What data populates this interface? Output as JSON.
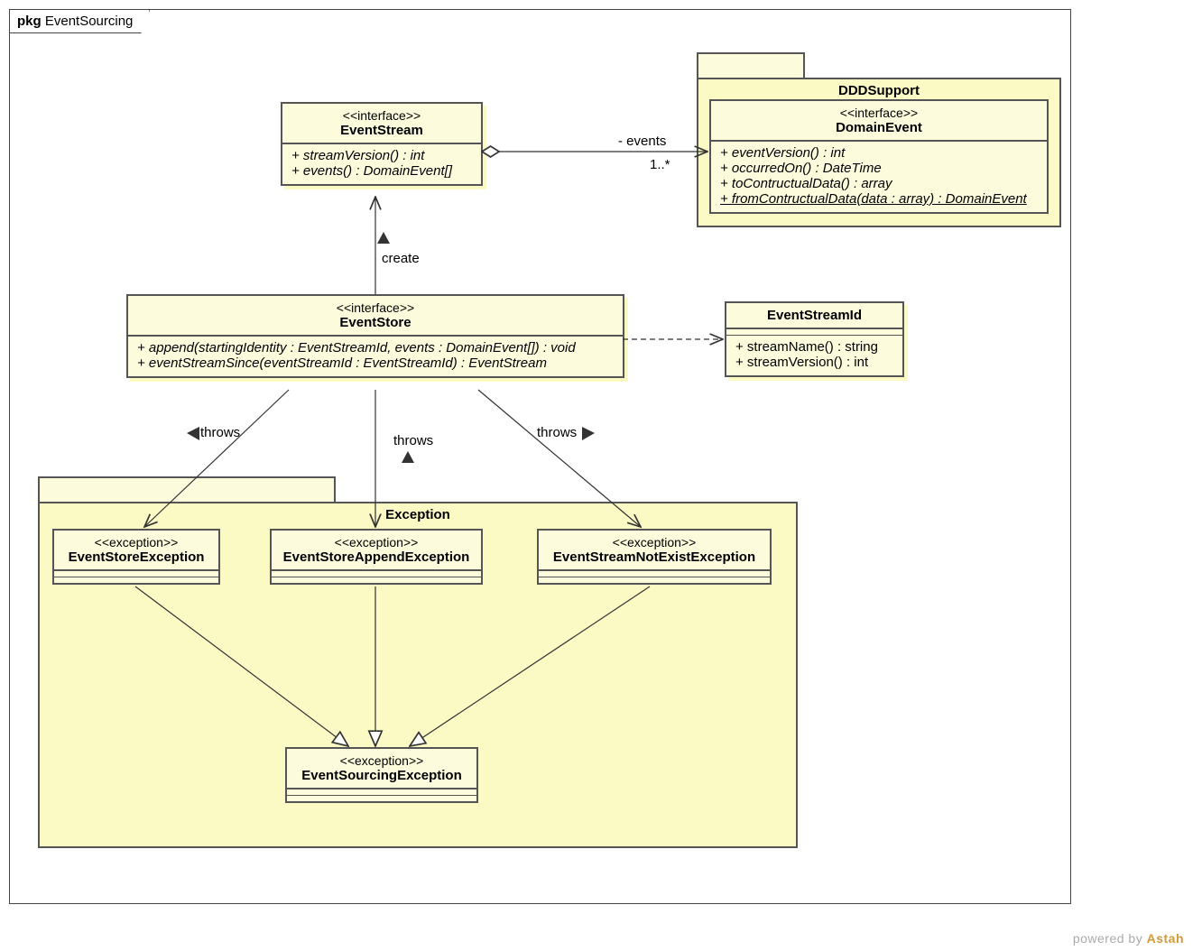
{
  "frame": {
    "prefix": "pkg",
    "name": "EventSourcing"
  },
  "eventStream": {
    "stereo": "<<interface>>",
    "name": "EventStream",
    "ops": [
      "+ streamVersion() : int",
      "+ events() : DomainEvent[]"
    ]
  },
  "dddSupportPkg": {
    "name": "DDDSupport"
  },
  "domainEvent": {
    "stereo": "<<interface>>",
    "name": "DomainEvent",
    "ops": [
      "+ eventVersion() : int",
      "+ occurredOn() : DateTime",
      "+ toContructualData() : array",
      "+ fromContructualData(data : array) : DomainEvent"
    ]
  },
  "eventStore": {
    "stereo": "<<interface>>",
    "name": "EventStore",
    "ops": [
      "+ append(startingIdentity : EventStreamId, events : DomainEvent[]) : void",
      "+ eventStreamSince(eventStreamId : EventStreamId) : EventStream"
    ]
  },
  "eventStreamId": {
    "name": "EventStreamId",
    "ops": [
      "+ streamName() : string",
      "+ streamVersion() : int"
    ]
  },
  "exceptionPkg": {
    "name": "Exception"
  },
  "exStore": {
    "stereo": "<<exception>>",
    "name": "EventStoreException"
  },
  "exAppend": {
    "stereo": "<<exception>>",
    "name": "EventStoreAppendException"
  },
  "exNotExist": {
    "stereo": "<<exception>>",
    "name": "EventStreamNotExistException"
  },
  "exBase": {
    "stereo": "<<exception>>",
    "name": "EventSourcingException"
  },
  "labels": {
    "events": "- events",
    "mult": "1..*",
    "create": "create",
    "throws": "throws"
  },
  "footer": {
    "text": "powered by ",
    "brand": "Astah"
  }
}
